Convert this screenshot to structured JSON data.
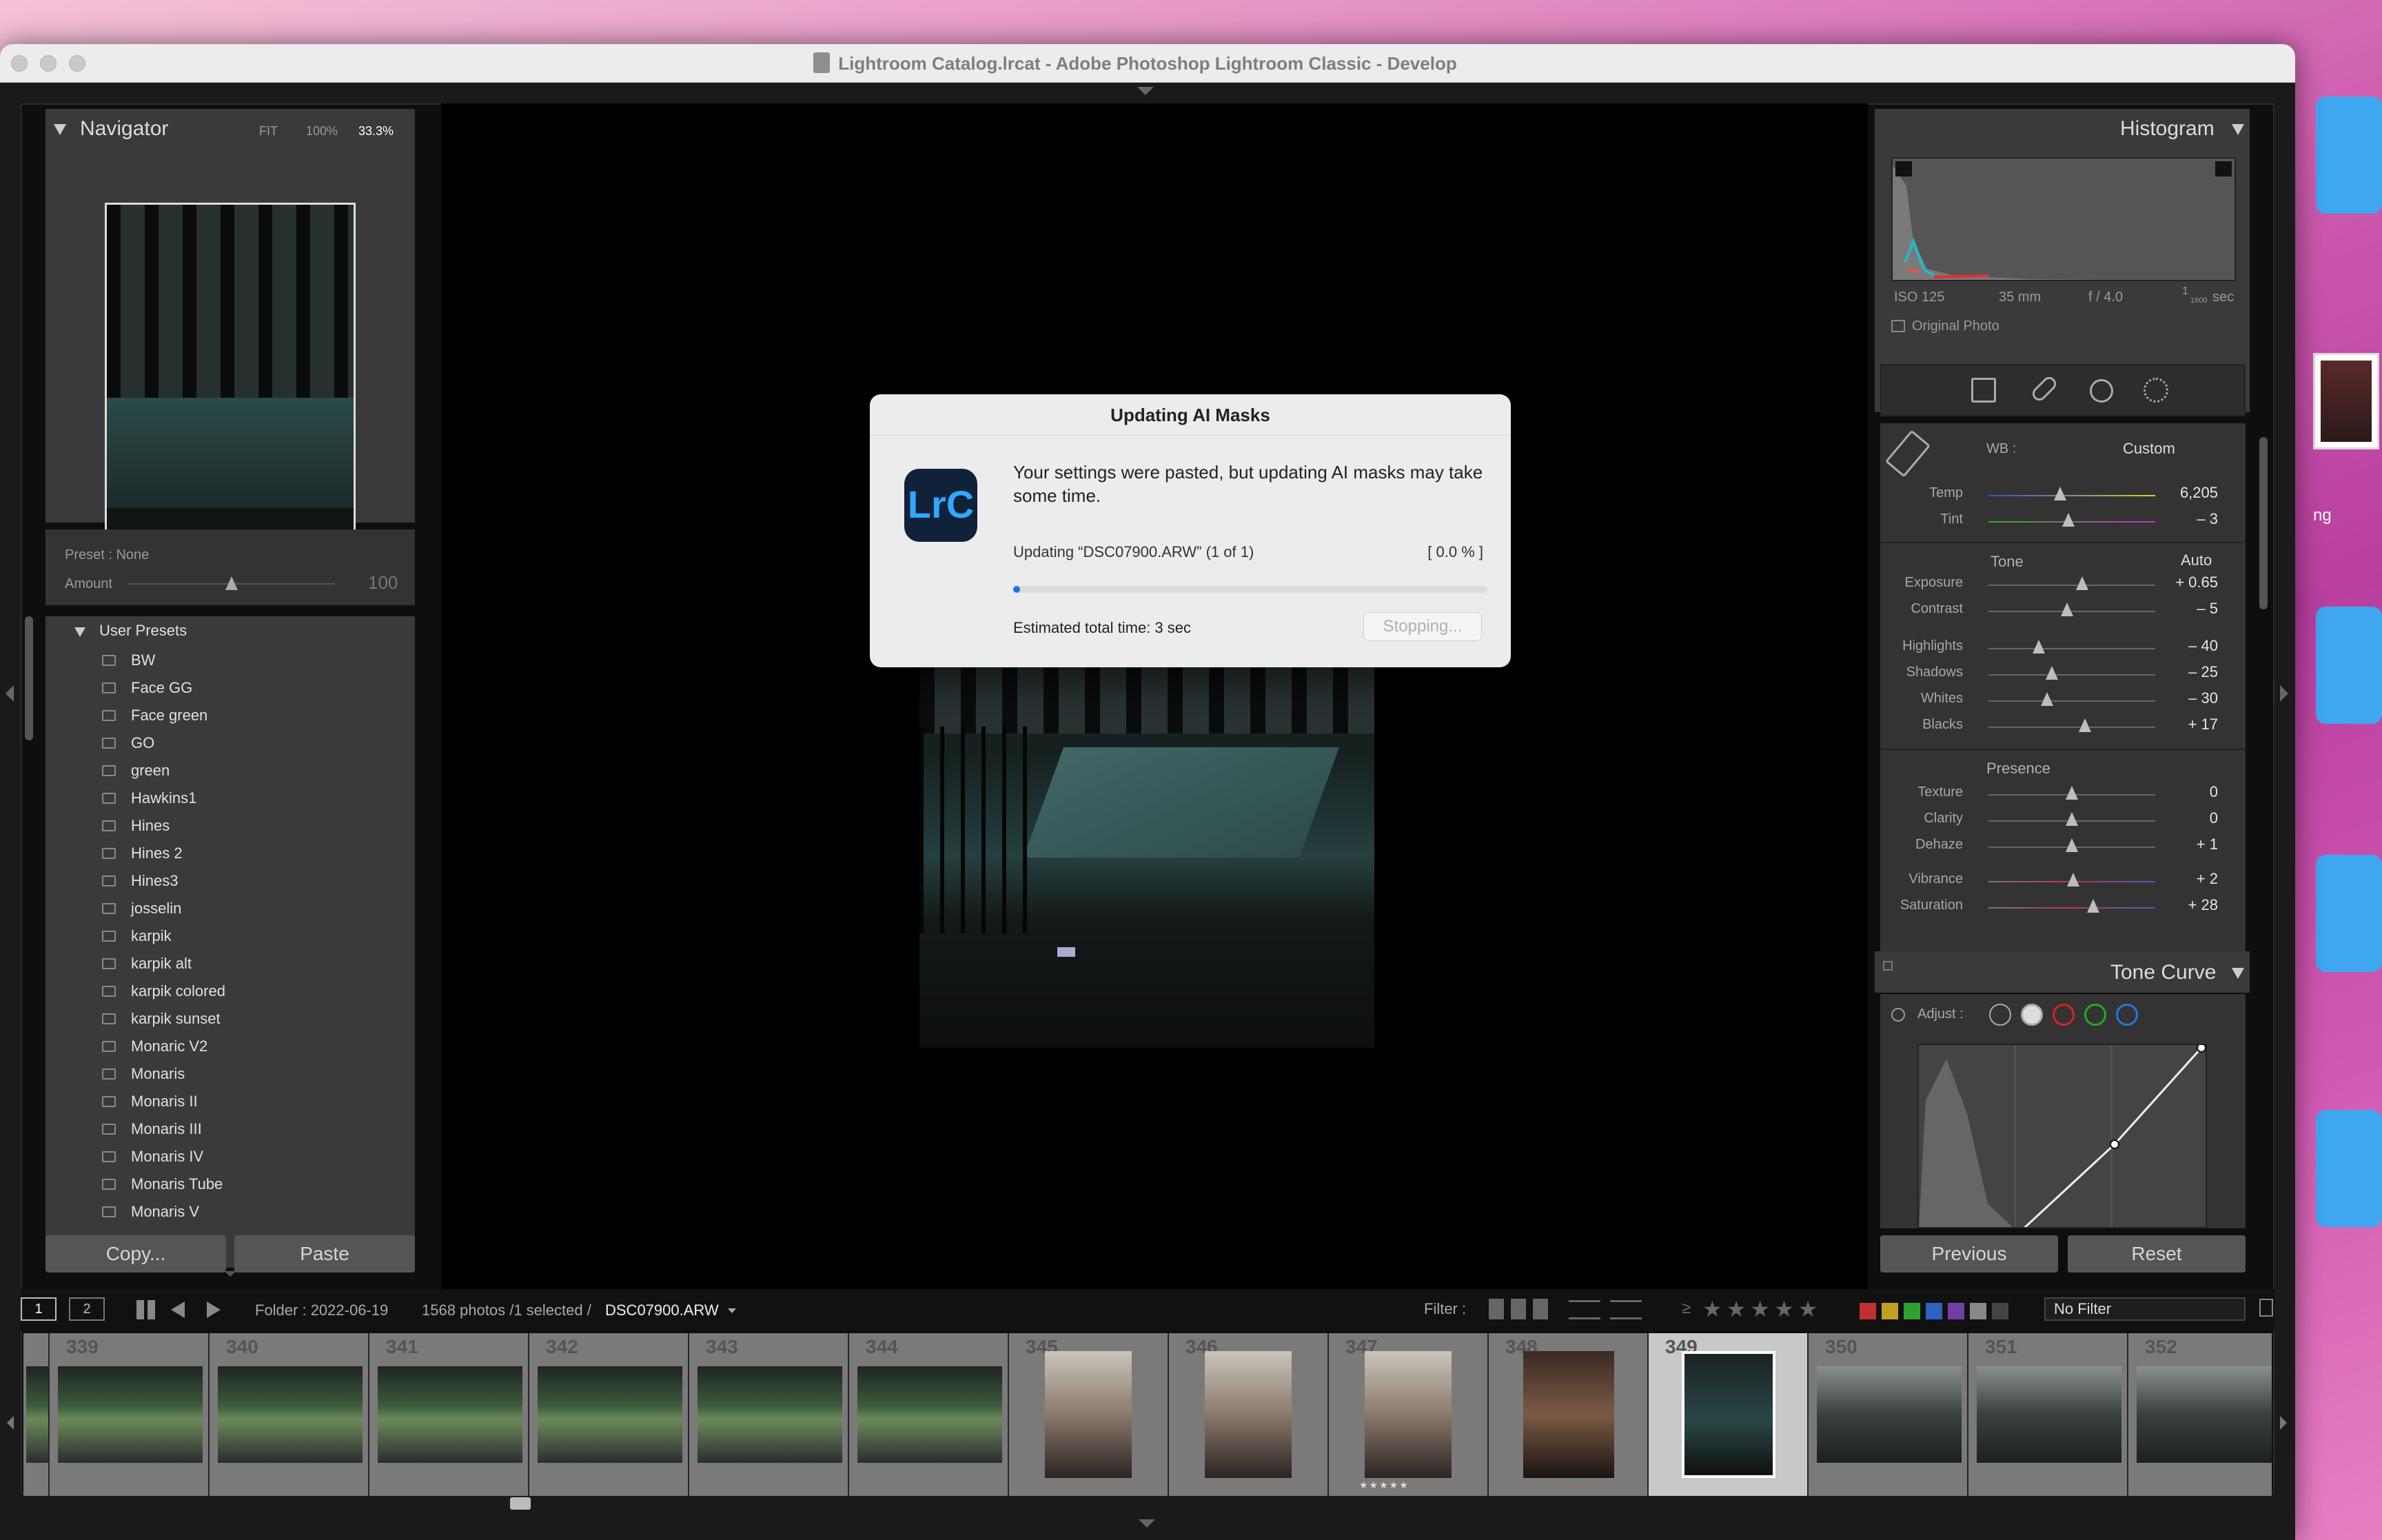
{
  "window": {
    "title": "Lightroom Catalog.lrcat - Adobe Photoshop Lightroom Classic - Develop"
  },
  "desktop": {
    "side_label": "ng"
  },
  "navigator": {
    "title": "Navigator",
    "zoom_fit": "FIT",
    "zoom_100": "100%",
    "zoom_current": "33.3%"
  },
  "preset_amount": {
    "preset_label": "Preset : None",
    "amount_label": "Amount",
    "amount_value": "100",
    "amount_level": 0.5
  },
  "presets": {
    "group": "User Presets",
    "items": [
      "BW",
      "Face GG",
      "Face green",
      "GO",
      "green",
      "Hawkins1",
      "Hines",
      "Hines 2",
      "Hines3",
      "josselin",
      "karpik",
      "karpik alt",
      "karpik colored",
      "karpik sunset",
      "Monaric V2",
      "Monaris",
      "Monaris II",
      "Monaris III",
      "Monaris IV",
      "Monaris Tube",
      "Monaris V"
    ]
  },
  "left_buttons": {
    "copy": "Copy...",
    "paste": "Paste"
  },
  "histogram": {
    "title": "Histogram",
    "iso": "ISO 125",
    "focal": "35 mm",
    "aperture": "f / 4.0",
    "shutter_num": "1",
    "shutter_den": "1600",
    "shutter_unit": "sec",
    "original_photo": "Original Photo"
  },
  "basic": {
    "wb_label": "WB :",
    "wb_value": "Custom",
    "tone_label": "Tone",
    "auto_label": "Auto",
    "presence_label": "Presence",
    "temp": {
      "label": "Temp",
      "value": "6,205",
      "level": 0.43
    },
    "tint": {
      "label": "Tint",
      "value": "– 3",
      "level": 0.48
    },
    "exposure": {
      "label": "Exposure",
      "value": "+ 0.65",
      "level": 0.56
    },
    "contrast": {
      "label": "Contrast",
      "value": "– 5",
      "level": 0.47
    },
    "highlights": {
      "label": "Highlights",
      "value": "– 40",
      "level": 0.3
    },
    "shadows": {
      "label": "Shadows",
      "value": "– 25",
      "level": 0.38
    },
    "whites": {
      "label": "Whites",
      "value": "– 30",
      "level": 0.35
    },
    "blacks": {
      "label": "Blacks",
      "value": "+ 17",
      "level": 0.58
    },
    "texture": {
      "label": "Texture",
      "value": "0",
      "level": 0.5
    },
    "clarity": {
      "label": "Clarity",
      "value": "0",
      "level": 0.5
    },
    "dehaze": {
      "label": "Dehaze",
      "value": "+ 1",
      "level": 0.5
    },
    "vibrance": {
      "label": "Vibrance",
      "value": "+ 2",
      "level": 0.51
    },
    "saturation": {
      "label": "Saturation",
      "value": "+ 28",
      "level": 0.63
    }
  },
  "tone_curve": {
    "title": "Tone Curve",
    "adjust_label": "Adjust :"
  },
  "right_buttons": {
    "previous": "Previous",
    "reset": "Reset"
  },
  "filmstrip_bar": {
    "view1": "1",
    "view2": "2",
    "folder": "Folder : 2022-06-19",
    "count": "1568 photos /1 selected /",
    "filename": "DSC07900.ARW",
    "filter_label": "Filter :",
    "gte": "≥",
    "no_filter": "No Filter"
  },
  "filmstrip": {
    "numbers": [
      "339",
      "340",
      "341",
      "342",
      "343",
      "344",
      "345",
      "346",
      "347",
      "348",
      "349",
      "350",
      "351",
      "352"
    ],
    "stars_347": "★★★★★"
  },
  "dialog": {
    "title": "Updating AI Masks",
    "app_icon_text": "LrC",
    "message": "Your settings were pasted, but updating AI masks may take some time.",
    "status": "Updating “DSC07900.ARW” (1 of 1)",
    "percent": "[ 0.0 % ]",
    "progress": 0.0,
    "estimate": "Estimated total time: 3 sec",
    "stop_button": "Stopping..."
  },
  "colors": {
    "accent": "#1e73e8",
    "lrc_icon_bg": "#0f2239",
    "lrc_icon_text": "#31a8ff"
  }
}
